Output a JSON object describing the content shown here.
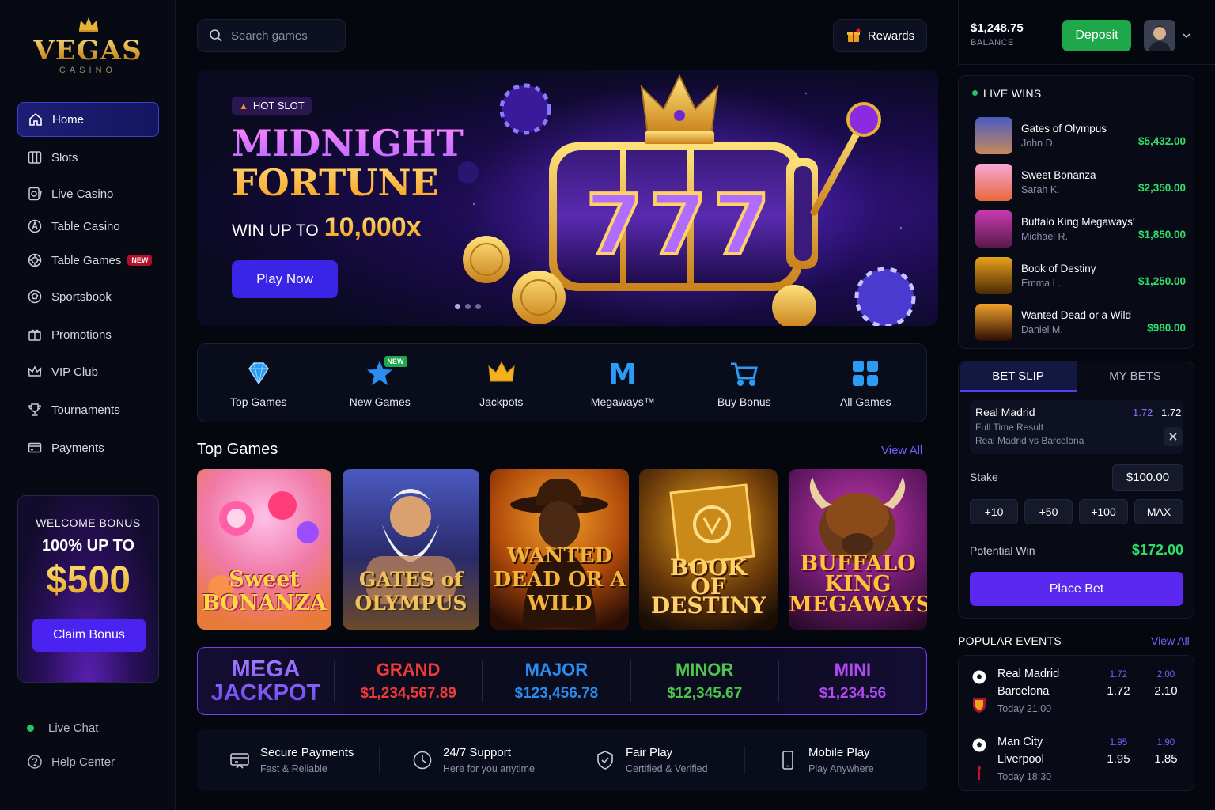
{
  "logo": {
    "name": "VEGAS",
    "sub": "CASINO"
  },
  "sidebar": {
    "items": [
      {
        "label": "Home",
        "icon": "home-icon",
        "active": true
      },
      {
        "label": "Slots",
        "icon": "slots-icon"
      },
      {
        "label": "Live Casino",
        "icon": "live-casino-icon"
      },
      {
        "label": "Table Casino",
        "icon": "table-casino-icon"
      },
      {
        "label": "Table Games",
        "icon": "table-games-icon",
        "badge": "NEW"
      },
      {
        "label": "Sportsbook",
        "icon": "soccer-ball-icon"
      },
      {
        "label": "Promotions",
        "icon": "gift-icon"
      },
      {
        "label": "VIP Club",
        "icon": "crown-icon"
      },
      {
        "label": "Tournaments",
        "icon": "trophy-icon"
      },
      {
        "label": "Payments",
        "icon": "wallet-icon"
      }
    ],
    "bonus": {
      "line1": "WELCOME BONUS",
      "line2": "100% UP TO",
      "amount": "$500",
      "button": "Claim Bonus"
    },
    "footer": [
      {
        "label": "Live Chat",
        "icon": "online-dot-icon"
      },
      {
        "label": "Help Center",
        "icon": "help-icon"
      }
    ]
  },
  "header": {
    "search_placeholder": "Search games",
    "rewards": "Rewards"
  },
  "hero": {
    "tag": "HOT SLOT",
    "title_1": "MIDNIGHT",
    "title_2": "FORTUNE",
    "win_prefix": "WIN UP TO",
    "win_value": "10,000x",
    "button": "Play Now",
    "slot_symbols": "777"
  },
  "categories": [
    {
      "label": "Top Games",
      "icon": "diamond-icon"
    },
    {
      "label": "New Games",
      "icon": "star-icon",
      "badge": "NEW"
    },
    {
      "label": "Jackpots",
      "icon": "crown-icon"
    },
    {
      "label": "Megaways™",
      "icon": "megaways-icon",
      "glyph": "M"
    },
    {
      "label": "Buy Bonus",
      "icon": "cart-icon"
    },
    {
      "label": "All Games",
      "icon": "grid-icon"
    }
  ],
  "top_games": {
    "title": "Top Games",
    "view_all": "View All",
    "games": [
      {
        "title": "Sweet\nBONANZA",
        "colors": [
          "#f7a8d8",
          "#f08a4a"
        ]
      },
      {
        "title": "GATES of\nOLYMPUS",
        "colors": [
          "#3a3f8a",
          "#c79a4a"
        ]
      },
      {
        "title": "WANTED\nDEAD OR A WILD",
        "colors": [
          "#e08a1a",
          "#3a1a0a"
        ]
      },
      {
        "title": "BOOK\nOF\nDESTINY",
        "colors": [
          "#6a3a0a",
          "#1a0d05"
        ]
      },
      {
        "title": "BUFFALO\nKING\nMEGAWAYS™",
        "colors": [
          "#b0389a",
          "#3a1a4a"
        ]
      }
    ]
  },
  "jackpot": {
    "mega_1": "MEGA",
    "mega_2": "JACKPOT",
    "tiers": [
      {
        "name": "GRAND",
        "value": "$1,234,567.89",
        "color": "#f03a3a"
      },
      {
        "name": "MAJOR",
        "value": "$123,456.78",
        "color": "#2a8cf0"
      },
      {
        "name": "MINOR",
        "value": "$12,345.67",
        "color": "#4ec44e"
      },
      {
        "name": "MINI",
        "value": "$1,234.56",
        "color": "#b14af0"
      }
    ]
  },
  "features": [
    {
      "title": "Secure Payments",
      "sub": "Fast & Reliable",
      "icon": "secure-payment-icon"
    },
    {
      "title": "24/7 Support",
      "sub": "Here for you anytime",
      "icon": "clock-icon"
    },
    {
      "title": "Fair Play",
      "sub": "Certified & Verified",
      "icon": "shield-icon"
    },
    {
      "title": "Mobile Play",
      "sub": "Play Anywhere",
      "icon": "mobile-icon"
    }
  ],
  "account": {
    "balance": "$1,248.75",
    "balance_label": "BALANCE",
    "deposit": "Deposit"
  },
  "live_wins": {
    "title": "LIVE WINS",
    "items": [
      {
        "game": "Gates of Olympus",
        "user": "John D.",
        "amount": "$5,432.00"
      },
      {
        "game": "Sweet Bonanza",
        "user": "Sarah K.",
        "amount": "$2,350.00"
      },
      {
        "game": "Buffalo King Megaways'",
        "user": "Michael R.",
        "amount": "$1,850.00"
      },
      {
        "game": "Book of Destiny",
        "user": "Emma L.",
        "amount": "$1,250.00"
      },
      {
        "game": "Wanted Dead or a Wild",
        "user": "Daniel M.",
        "amount": "$980.00"
      }
    ]
  },
  "bet_slip": {
    "tab_slip": "BET SLIP",
    "tab_bets": "MY BETS",
    "selection": {
      "team": "Real Madrid",
      "odds_old": "1.72",
      "odds": "1.72",
      "market": "Full Time Result",
      "match": "Real Madrid vs Barcelona"
    },
    "stake_label": "Stake",
    "stake_value": "$100.00",
    "chips": [
      "+10",
      "+50",
      "+100",
      "MAX"
    ],
    "potential_label": "Potential Win",
    "potential_value": "$172.00",
    "place_bet": "Place Bet"
  },
  "popular_events": {
    "title": "POPULAR EVENTS",
    "view_all": "View All",
    "events": [
      {
        "home": "Real Madrid",
        "away": "Barcelona",
        "time": "Today 21:00",
        "odds": [
          {
            "top": "1.72",
            "val": "1.72"
          },
          {
            "top": "2.00",
            "val": "2.10"
          }
        ]
      },
      {
        "home": "Man City",
        "away": "Liverpool",
        "time": "Today 18:30",
        "odds": [
          {
            "top": "1.95",
            "val": "1.95"
          },
          {
            "top": "1.90",
            "val": "1.85"
          }
        ]
      }
    ]
  },
  "colors": {
    "accent": "#4a23f0",
    "green": "#1ea84a",
    "gold": "#f2b21e",
    "purple_link": "#7b5cff"
  }
}
